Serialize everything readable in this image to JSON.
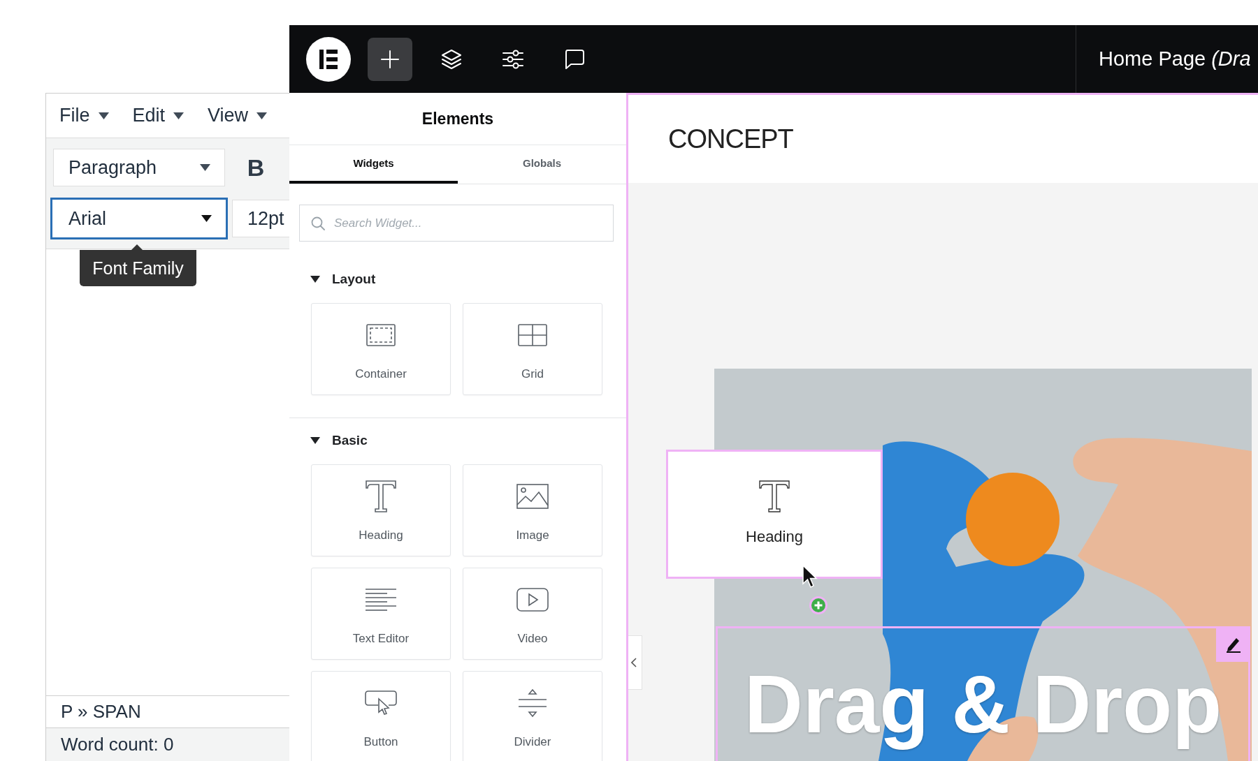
{
  "editor": {
    "menubar": [
      {
        "label": "File"
      },
      {
        "label": "Edit"
      },
      {
        "label": "View"
      }
    ],
    "toolbar": {
      "block_format": "Paragraph",
      "bold_label": "B",
      "font_family": {
        "value": "Arial",
        "focused": true
      },
      "font_size": "12pt"
    },
    "tooltip": "Font Family",
    "element_path": "P » SPAN",
    "word_count": "Word count: 0"
  },
  "topbar": {
    "tools": [
      {
        "kind": "add",
        "selected": true
      },
      {
        "kind": "layers",
        "selected": false
      },
      {
        "kind": "settings",
        "selected": false
      },
      {
        "kind": "comments",
        "selected": false
      }
    ],
    "title": "Home Page *(Dra*"
  },
  "panel": {
    "title": "Elements",
    "tabs": [
      {
        "label": "Widgets",
        "selected": true
      },
      {
        "label": "Globals",
        "selected": false
      }
    ],
    "search": {
      "placeholder": "Search Widget..."
    },
    "sections": [
      {
        "title": "Layout",
        "expanded": true,
        "widgets": [
          {
            "kind": "container",
            "label": "Container"
          },
          {
            "kind": "grid",
            "label": "Grid"
          }
        ]
      },
      {
        "title": "Basic",
        "expanded": true,
        "widgets": [
          {
            "kind": "heading",
            "label": "Heading"
          },
          {
            "kind": "image",
            "label": "Image"
          },
          {
            "kind": "text-editor",
            "label": "Text Editor"
          },
          {
            "kind": "video",
            "label": "Video"
          },
          {
            "kind": "button",
            "label": "Button"
          },
          {
            "kind": "divider",
            "label": "Divider"
          }
        ]
      }
    ]
  },
  "canvas": {
    "logo": "CONCEPT",
    "drag_preview": {
      "kind": "heading",
      "label": "Heading"
    },
    "hero_heading": "Drag & Drop"
  }
}
